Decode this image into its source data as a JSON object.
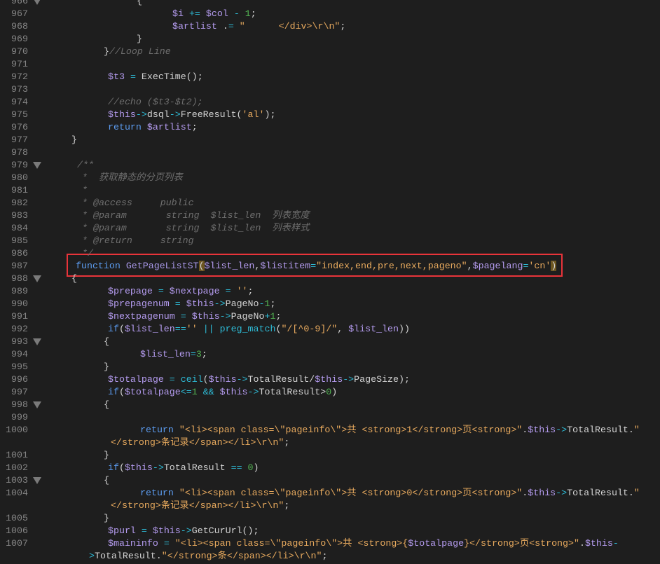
{
  "theme": {
    "background": "#1e1e1e",
    "highlight_box": "#e8343a"
  },
  "lines": [
    {
      "num": "966",
      "fold": true,
      "rows": [
        [
          [
            "p",
            "{"
          ]
        ]
      ]
    },
    {
      "num": "967",
      "rows": [
        [
          [
            "v",
            "$i"
          ],
          [
            "p",
            " "
          ],
          [
            "o",
            "+="
          ],
          [
            "p",
            " "
          ],
          [
            "v",
            "$col"
          ],
          [
            "p",
            " "
          ],
          [
            "o",
            "-"
          ],
          [
            "p",
            " "
          ],
          [
            "n",
            "1"
          ],
          [
            "p",
            ";"
          ]
        ]
      ]
    },
    {
      "num": "968",
      "rows": [
        [
          [
            "v",
            "$artlist"
          ],
          [
            "p",
            " ."
          ],
          [
            "o",
            "="
          ],
          [
            "p",
            " "
          ],
          [
            "s",
            "\"      </div>\\r\\n\""
          ],
          [
            "p",
            ";"
          ]
        ]
      ]
    },
    {
      "num": "969",
      "rows": [
        [
          [
            "p",
            "}"
          ]
        ]
      ]
    },
    {
      "num": "970",
      "rows": [
        [
          [
            "p",
            "}"
          ],
          [
            "c",
            "//Loop Line"
          ]
        ]
      ]
    },
    {
      "num": "971",
      "rows": [
        []
      ]
    },
    {
      "num": "972",
      "rows": [
        [
          [
            "v",
            "$t3"
          ],
          [
            "p",
            " "
          ],
          [
            "o",
            "="
          ],
          [
            "p",
            " ExecTime();"
          ]
        ]
      ]
    },
    {
      "num": "973",
      "rows": [
        []
      ]
    },
    {
      "num": "974",
      "rows": [
        [
          [
            "c",
            "//echo ($t3-$t2);"
          ]
        ]
      ]
    },
    {
      "num": "975",
      "rows": [
        [
          [
            "v",
            "$this"
          ],
          [
            "o",
            "->"
          ],
          [
            "p",
            "dsql"
          ],
          [
            "o",
            "->"
          ],
          [
            "p",
            "FreeResult("
          ],
          [
            "s",
            "'al'"
          ],
          [
            "p",
            ");"
          ]
        ]
      ]
    },
    {
      "num": "976",
      "rows": [
        [
          [
            "k",
            "return"
          ],
          [
            "p",
            " "
          ],
          [
            "v",
            "$artlist"
          ],
          [
            "p",
            ";"
          ]
        ]
      ]
    },
    {
      "num": "977",
      "rows": [
        [
          [
            "p",
            "}"
          ]
        ]
      ]
    },
    {
      "num": "978",
      "rows": [
        []
      ]
    },
    {
      "num": "979",
      "fold": true,
      "rows": [
        [
          [
            "c",
            "/**"
          ]
        ]
      ]
    },
    {
      "num": "980",
      "rows": [
        [
          [
            "c",
            "*  获取静态的分页列表"
          ]
        ]
      ]
    },
    {
      "num": "981",
      "rows": [
        [
          [
            "c",
            "*"
          ]
        ]
      ]
    },
    {
      "num": "982",
      "rows": [
        [
          [
            "c",
            "* @access     public"
          ]
        ]
      ]
    },
    {
      "num": "983",
      "rows": [
        [
          [
            "c",
            "* @param       string  $list_len  列表宽度"
          ]
        ]
      ]
    },
    {
      "num": "984",
      "rows": [
        [
          [
            "c",
            "* @param       string  $list_len  列表样式"
          ]
        ]
      ]
    },
    {
      "num": "985",
      "rows": [
        [
          [
            "c",
            "* @return     string"
          ]
        ]
      ]
    },
    {
      "num": "986",
      "rows": [
        [
          [
            "c",
            "*/"
          ]
        ]
      ]
    },
    {
      "num": "987",
      "rows": [
        [
          [
            "k",
            "function"
          ],
          [
            "p",
            " "
          ],
          [
            "f",
            "GetPageListST"
          ],
          [
            "b",
            "("
          ],
          [
            "v",
            "$list_len"
          ],
          [
            "p",
            ","
          ],
          [
            "v",
            "$listitem"
          ],
          [
            "o",
            "="
          ],
          [
            "s",
            "\"index,end,pre,next,pageno\""
          ],
          [
            "p",
            ","
          ],
          [
            "v",
            "$pagelang"
          ],
          [
            "o",
            "="
          ],
          [
            "s",
            "'cn'"
          ],
          [
            "b",
            ")"
          ]
        ]
      ]
    },
    {
      "num": "988",
      "fold": true,
      "rows": [
        [
          [
            "p",
            "{"
          ]
        ]
      ]
    },
    {
      "num": "989",
      "rows": [
        [
          [
            "v",
            "$prepage"
          ],
          [
            "p",
            " "
          ],
          [
            "o",
            "="
          ],
          [
            "p",
            " "
          ],
          [
            "v",
            "$nextpage"
          ],
          [
            "p",
            " "
          ],
          [
            "o",
            "="
          ],
          [
            "p",
            " "
          ],
          [
            "s",
            "''"
          ],
          [
            "p",
            ";"
          ]
        ]
      ]
    },
    {
      "num": "990",
      "rows": [
        [
          [
            "v",
            "$prepagenum"
          ],
          [
            "p",
            " "
          ],
          [
            "o",
            "="
          ],
          [
            "p",
            " "
          ],
          [
            "v",
            "$this"
          ],
          [
            "o",
            "->"
          ],
          [
            "p",
            "PageNo"
          ],
          [
            "o",
            "-"
          ],
          [
            "n",
            "1"
          ],
          [
            "p",
            ";"
          ]
        ]
      ]
    },
    {
      "num": "991",
      "rows": [
        [
          [
            "v",
            "$nextpagenum"
          ],
          [
            "p",
            " "
          ],
          [
            "o",
            "="
          ],
          [
            "p",
            " "
          ],
          [
            "v",
            "$this"
          ],
          [
            "o",
            "->"
          ],
          [
            "p",
            "PageNo"
          ],
          [
            "o",
            "+"
          ],
          [
            "n",
            "1"
          ],
          [
            "p",
            ";"
          ]
        ]
      ]
    },
    {
      "num": "992",
      "rows": [
        [
          [
            "k",
            "if"
          ],
          [
            "p",
            "("
          ],
          [
            "v",
            "$list_len"
          ],
          [
            "o",
            "=="
          ],
          [
            "s",
            "''"
          ],
          [
            "p",
            " "
          ],
          [
            "o",
            "||"
          ],
          [
            "p",
            " "
          ],
          [
            "o",
            "preg_match"
          ],
          [
            "p",
            "("
          ],
          [
            "s",
            "\"/[^0-9]/\""
          ],
          [
            "p",
            ", "
          ],
          [
            "v",
            "$list_len"
          ],
          [
            "p",
            "))"
          ]
        ]
      ]
    },
    {
      "num": "993",
      "fold": true,
      "rows": [
        [
          [
            "p",
            "{"
          ]
        ]
      ]
    },
    {
      "num": "994",
      "rows": [
        [
          [
            "v",
            "$list_len"
          ],
          [
            "o",
            "="
          ],
          [
            "n",
            "3"
          ],
          [
            "p",
            ";"
          ]
        ]
      ]
    },
    {
      "num": "995",
      "rows": [
        [
          [
            "p",
            "}"
          ]
        ]
      ]
    },
    {
      "num": "996",
      "rows": [
        [
          [
            "v",
            "$totalpage"
          ],
          [
            "p",
            " "
          ],
          [
            "o",
            "="
          ],
          [
            "p",
            " "
          ],
          [
            "o",
            "ceil"
          ],
          [
            "p",
            "("
          ],
          [
            "v",
            "$this"
          ],
          [
            "o",
            "->"
          ],
          [
            "p",
            "TotalResult/"
          ],
          [
            "v",
            "$this"
          ],
          [
            "o",
            "->"
          ],
          [
            "p",
            "PageSize);"
          ]
        ]
      ]
    },
    {
      "num": "997",
      "rows": [
        [
          [
            "k",
            "if"
          ],
          [
            "p",
            "("
          ],
          [
            "v",
            "$totalpage"
          ],
          [
            "o",
            "<="
          ],
          [
            "n",
            "1"
          ],
          [
            "p",
            " "
          ],
          [
            "o",
            "&&"
          ],
          [
            "p",
            " "
          ],
          [
            "v",
            "$this"
          ],
          [
            "o",
            "->"
          ],
          [
            "p",
            "TotalResult>"
          ],
          [
            "n",
            "0"
          ],
          [
            "p",
            ")"
          ]
        ]
      ]
    },
    {
      "num": "998",
      "fold": true,
      "rows": [
        [
          [
            "p",
            "{"
          ]
        ]
      ]
    },
    {
      "num": "999",
      "rows": [
        []
      ]
    },
    {
      "num": "1000",
      "rows": [
        [
          [
            "k",
            "return"
          ],
          [
            "p",
            " "
          ],
          [
            "s",
            "\"<li><span class=\\\"pageinfo\\\">共 <strong>1</strong>页<strong>\""
          ],
          [
            "p",
            "."
          ],
          [
            "v",
            "$this"
          ],
          [
            "o",
            "->"
          ],
          [
            "p",
            "TotalResult."
          ],
          [
            "s",
            "\""
          ]
        ],
        [
          [
            "s",
            "</strong>条记录</span></li>\\r\\n\""
          ],
          [
            "p",
            ";"
          ]
        ]
      ]
    },
    {
      "num": "1001",
      "rows": [
        [
          [
            "p",
            "}"
          ]
        ]
      ]
    },
    {
      "num": "1002",
      "rows": [
        [
          [
            "k",
            "if"
          ],
          [
            "p",
            "("
          ],
          [
            "v",
            "$this"
          ],
          [
            "o",
            "->"
          ],
          [
            "p",
            "TotalResult "
          ],
          [
            "o",
            "=="
          ],
          [
            "p",
            " "
          ],
          [
            "n",
            "0"
          ],
          [
            "p",
            ")"
          ]
        ]
      ]
    },
    {
      "num": "1003",
      "fold": true,
      "rows": [
        [
          [
            "p",
            "{"
          ]
        ]
      ]
    },
    {
      "num": "1004",
      "rows": [
        [
          [
            "k",
            "return"
          ],
          [
            "p",
            " "
          ],
          [
            "s",
            "\"<li><span class=\\\"pageinfo\\\">共 <strong>0</strong>页<strong>\""
          ],
          [
            "p",
            "."
          ],
          [
            "v",
            "$this"
          ],
          [
            "o",
            "->"
          ],
          [
            "p",
            "TotalResult."
          ],
          [
            "s",
            "\""
          ]
        ],
        [
          [
            "s",
            "</strong>条记录</span></li>\\r\\n\""
          ],
          [
            "p",
            ";"
          ]
        ]
      ]
    },
    {
      "num": "1005",
      "rows": [
        [
          [
            "p",
            "}"
          ]
        ]
      ]
    },
    {
      "num": "1006",
      "rows": [
        [
          [
            "v",
            "$purl"
          ],
          [
            "p",
            " "
          ],
          [
            "o",
            "="
          ],
          [
            "p",
            " "
          ],
          [
            "v",
            "$this"
          ],
          [
            "o",
            "->"
          ],
          [
            "p",
            "GetCurUrl();"
          ]
        ]
      ]
    },
    {
      "num": "1007",
      "rows": [
        [
          [
            "v",
            "$maininfo"
          ],
          [
            "p",
            " "
          ],
          [
            "o",
            "="
          ],
          [
            "p",
            " "
          ],
          [
            "s",
            "\"<li><span class=\\\"pageinfo\\\">共 <strong>{"
          ],
          [
            "v",
            "$totalpage"
          ],
          [
            "s",
            "}</strong>页<strong>\""
          ],
          [
            "p",
            "."
          ],
          [
            "v",
            "$this"
          ],
          [
            "o",
            "-"
          ]
        ],
        [
          [
            "o",
            ">"
          ],
          [
            "p",
            "TotalResult."
          ],
          [
            "s",
            "\"</strong>条</span></li>\\r\\n\""
          ],
          [
            "p",
            ";"
          ]
        ]
      ]
    }
  ]
}
